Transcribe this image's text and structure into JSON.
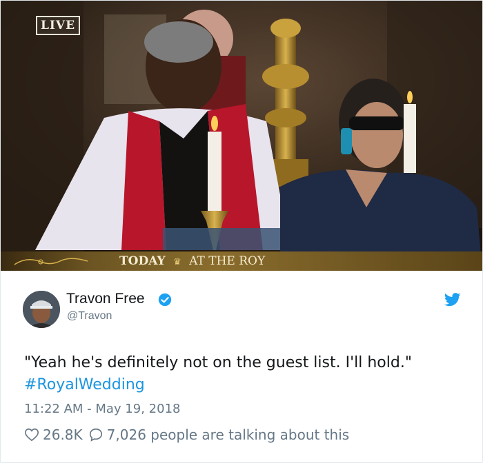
{
  "media": {
    "live_badge": "LIVE",
    "chyron_today": "TODAY",
    "chyron_rest": "AT THE ROY"
  },
  "tweet": {
    "author_name": "Travon Free",
    "author_handle": "@Travon",
    "text": "\"Yeah he's definitely not on the guest list. I'll hold.\"",
    "hashtag": "#RoyalWedding",
    "timestamp": "11:22 AM - May 19, 2018",
    "like_count": "26.8K",
    "reply_text": "7,026 people are talking about this"
  },
  "colors": {
    "link": "#1b95e0",
    "verified": "#1da1f2",
    "muted": "#657786",
    "text": "#14171a"
  },
  "icons": [
    "verified-badge-icon",
    "twitter-bird-icon",
    "heart-icon",
    "reply-bubble-icon"
  ]
}
